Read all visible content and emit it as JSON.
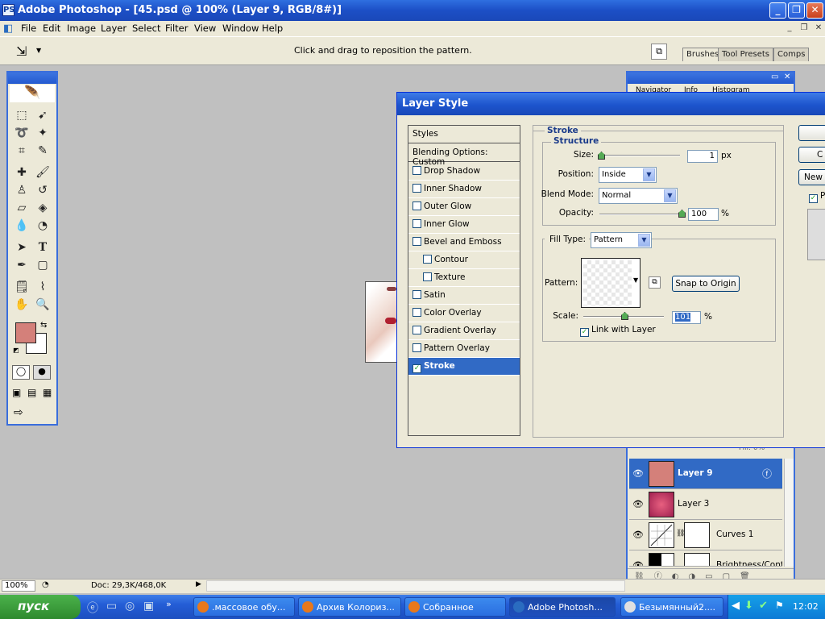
{
  "app": {
    "title": "Adobe Photoshop - [45.psd @ 100% (Layer 9, RGB/8#)]",
    "logo": "PS"
  },
  "menu": [
    "File",
    "Edit",
    "Image",
    "Layer",
    "Select",
    "Filter",
    "View",
    "Window",
    "Help"
  ],
  "options": {
    "hint": "Click and drag to reposition the pattern.",
    "dock_tabs": [
      "Brushes",
      "Tool Presets",
      "Comps"
    ]
  },
  "colors": {
    "foreground": "#d4807a",
    "background": "#ffffff",
    "accent": "#316ac5"
  },
  "icons": {
    "tools": [
      "marquee-icon",
      "move-icon",
      "lasso-icon",
      "magic-wand-icon",
      "crop-icon",
      "slice-icon",
      "healing-brush-icon",
      "brush-icon",
      "clone-stamp-icon",
      "history-brush-icon",
      "eraser-icon",
      "paint-bucket-icon",
      "blur-icon",
      "dodge-icon",
      "path-select-icon",
      "type-icon",
      "pen-icon",
      "shape-icon",
      "notes-icon",
      "eyedropper-icon",
      "hand-icon",
      "zoom-icon"
    ]
  },
  "dialog": {
    "title": "Layer Style",
    "styles_header": "Styles",
    "blending": "Blending Options: Custom",
    "effects": [
      {
        "label": "Drop Shadow",
        "checked": false,
        "indent": false
      },
      {
        "label": "Inner Shadow",
        "checked": false,
        "indent": false
      },
      {
        "label": "Outer Glow",
        "checked": false,
        "indent": false
      },
      {
        "label": "Inner Glow",
        "checked": false,
        "indent": false
      },
      {
        "label": "Bevel and Emboss",
        "checked": false,
        "indent": false
      },
      {
        "label": "Contour",
        "checked": false,
        "indent": true
      },
      {
        "label": "Texture",
        "checked": false,
        "indent": true
      },
      {
        "label": "Satin",
        "checked": false,
        "indent": false
      },
      {
        "label": "Color Overlay",
        "checked": false,
        "indent": false
      },
      {
        "label": "Gradient Overlay",
        "checked": false,
        "indent": false
      },
      {
        "label": "Pattern Overlay",
        "checked": false,
        "indent": false
      },
      {
        "label": "Stroke",
        "checked": true,
        "indent": false,
        "selected": true
      }
    ],
    "stroke": {
      "section": "Stroke",
      "structure": "Structure",
      "size_label": "Size:",
      "size": "1",
      "size_unit": "px",
      "position_label": "Position:",
      "position": "Inside",
      "blend_label": "Blend Mode:",
      "blend": "Normal",
      "opacity_label": "Opacity:",
      "opacity": "100",
      "opacity_unit": "%",
      "filltype_label": "Fill Type:",
      "filltype": "Pattern",
      "pattern_label": "Pattern:",
      "snap_button": "Snap to Origin",
      "scale_label": "Scale:",
      "scale": "101",
      "scale_unit": "%",
      "link_label": "Link with Layer",
      "link_checked": true
    },
    "side_buttons": [
      "",
      "C",
      "New"
    ],
    "preview_check": "P"
  },
  "layers": [
    {
      "name": "Layer 9",
      "selected": true,
      "thumb": "#d4807a"
    },
    {
      "name": "Layer 3",
      "selected": false,
      "thumb": "#c03050"
    },
    {
      "name": "Curves 1",
      "selected": false,
      "thumb": "#ffffff"
    },
    {
      "name": "Brightness/Cont...",
      "selected": false,
      "thumb": "#222222"
    }
  ],
  "layers_fill_label": "Fill: 0%",
  "panel_tabs": [
    "Navigator",
    "Info",
    "Histogram"
  ],
  "status": {
    "zoom": "100%",
    "doc": "Doc: 29,3K/468,0K"
  },
  "taskbar": {
    "start": "пуск",
    "buttons": [
      {
        "label": ".массовое обу...",
        "icon": "firefox-icon",
        "active": false
      },
      {
        "label": "Архив Колориз...",
        "icon": "firefox-icon",
        "active": false
      },
      {
        "label": "Собранное",
        "icon": "firefox-icon",
        "active": false
      },
      {
        "label": "Adobe Photosh...",
        "icon": "photoshop-icon",
        "active": true
      },
      {
        "label": "Безымянный2....",
        "icon": "paint-icon",
        "active": false
      }
    ],
    "clock": "12:02"
  }
}
